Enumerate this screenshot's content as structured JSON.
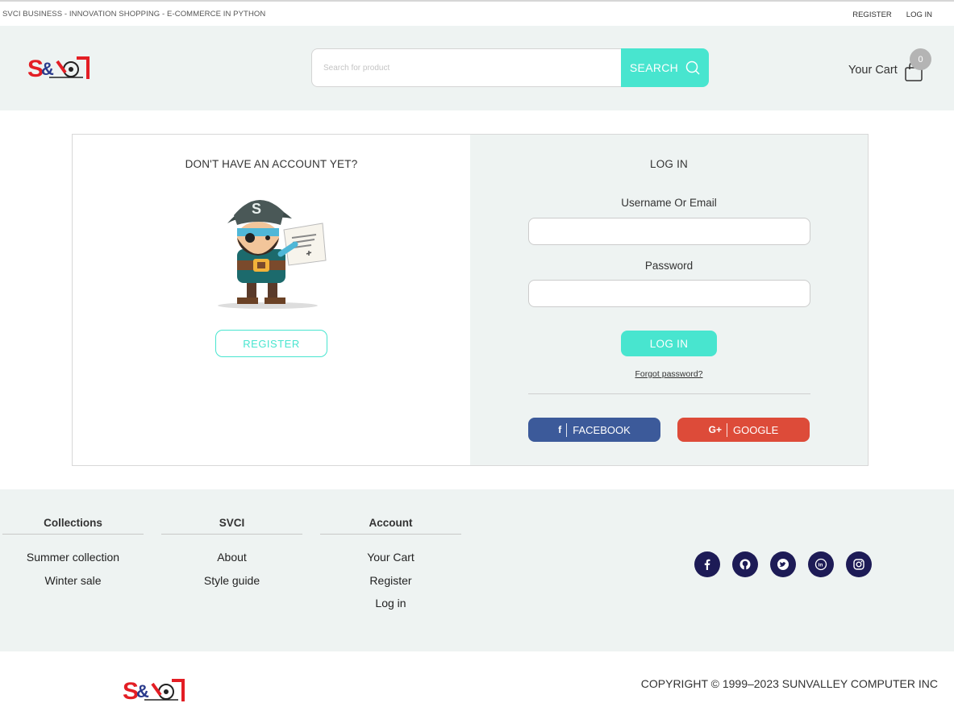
{
  "topbar": {
    "tagline": "SVCI BUSINESS - INNOVATION SHOPPING - E-COMMERCE IN PYTHON",
    "register": "REGISTER",
    "login": "LOG IN"
  },
  "header": {
    "logo_text": "SVCI",
    "search_placeholder": "Search for product",
    "search_button": "SEARCH",
    "cart_label": "Your Cart",
    "cart_count": "0"
  },
  "register_panel": {
    "title": "DON'T HAVE AN ACCOUNT YET?",
    "button": "REGISTER"
  },
  "login_panel": {
    "title": "LOG IN",
    "username_label": "Username Or Email",
    "password_label": "Password",
    "button": "LOG IN",
    "forgot": "Forgot password?",
    "facebook": "FACEBOOK",
    "google": "GOOGLE"
  },
  "footer": {
    "columns": [
      {
        "title": "Collections",
        "items": [
          "Summer collection",
          "Winter sale"
        ]
      },
      {
        "title": "SVCI",
        "items": [
          "About",
          "Style guide"
        ]
      },
      {
        "title": "Account",
        "items": [
          "Your Cart",
          "Register",
          "Log in"
        ]
      }
    ],
    "socials": [
      "facebook-icon",
      "github-icon",
      "twitter-icon",
      "linkedin-icon",
      "instagram-icon"
    ]
  },
  "bottom": {
    "copyright": "COPYRIGHT © 1999–2023 SUNVALLEY COMPUTER INC"
  },
  "colors": {
    "accent": "#48e5cf",
    "header_bg": "#eef3f2",
    "facebook": "#3c5a9a",
    "google": "#dd4b39",
    "social_bg": "#1d1b56",
    "logo_red": "#e31e24"
  }
}
